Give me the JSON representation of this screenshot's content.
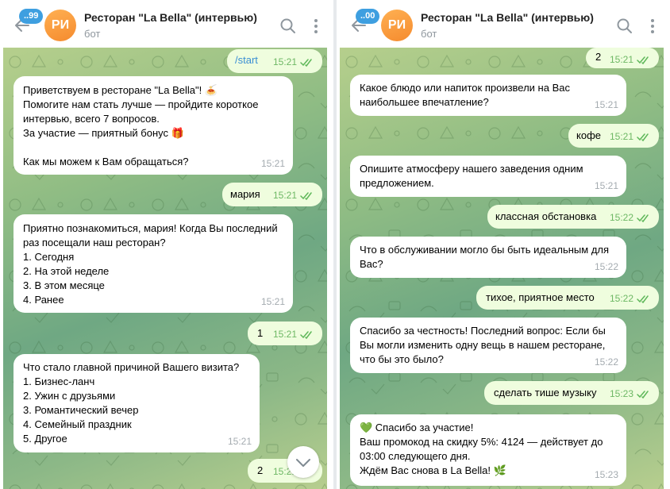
{
  "app": {
    "accent": "#3e9fe0",
    "incoming_bubble": "#ffffff",
    "outgoing_bubble": "#effdde"
  },
  "left": {
    "header": {
      "back_icon": "arrow-left-icon",
      "unread_badge": "..99",
      "avatar_initials": "РИ",
      "title": "Ресторан \"La Bella\" (интервью)",
      "subtitle": "бот",
      "search_icon": "search-icon",
      "more_icon": "more-vertical-icon"
    },
    "messages": [
      {
        "dir": "out",
        "text": "/start",
        "time": "15:21",
        "read": true
      },
      {
        "dir": "in",
        "text": "Приветствуем в ресторане \"La Bella\"! 🍝\nПомогите нам стать лучше — пройдите короткое интервью, всего 7 вопросов.\nЗа участие — приятный бонус 🎁\n\nКак мы можем к Вам обращаться?",
        "time": "15:21"
      },
      {
        "dir": "out",
        "text": "мария",
        "time": "15:21",
        "read": true
      },
      {
        "dir": "in",
        "text": "Приятно познакомиться, мария! Когда Вы последний раз посещали наш ресторан?\n1. Сегодня\n2. На этой неделе\n3. В этом месяце\n4. Ранее",
        "time": "15:21"
      },
      {
        "dir": "out",
        "text": "1",
        "time": "15:21",
        "read": true
      },
      {
        "dir": "in",
        "text": "Что стало главной причиной Вашего визита?\n1. Бизнес-ланч\n2. Ужин с друзьями\n3. Романтический вечер\n4. Семейный праздник\n5. Другое",
        "time": "15:21"
      },
      {
        "dir": "out",
        "text": "2",
        "time": "15:21",
        "read": true
      }
    ],
    "scroll_down_icon": "chevron-down-icon"
  },
  "right": {
    "header": {
      "back_icon": "arrow-left-icon",
      "unread_badge": "..00",
      "avatar_initials": "РИ",
      "title": "Ресторан \"La Bella\" (интервью)",
      "subtitle": "бот",
      "search_icon": "search-icon",
      "more_icon": "more-vertical-icon"
    },
    "messages": [
      {
        "dir": "out",
        "text": "2",
        "time": "15:21",
        "read": true
      },
      {
        "dir": "in",
        "text": "Какое блюдо или напиток произвели на Вас наибольшее впечатление?",
        "time": "15:21"
      },
      {
        "dir": "out",
        "text": "кофе",
        "time": "15:21",
        "read": true
      },
      {
        "dir": "in",
        "text": "Опишите атмосферу нашего заведения одним предложением.",
        "time": "15:21"
      },
      {
        "dir": "out",
        "text": "классная обстановка",
        "time": "15:22",
        "read": true
      },
      {
        "dir": "in",
        "text": "Что в обслуживании могло бы быть идеальным для Вас?",
        "time": "15:22"
      },
      {
        "dir": "out",
        "text": "тихое, приятное место",
        "time": "15:22",
        "read": true
      },
      {
        "dir": "in",
        "text": "Спасибо за честность! Последний вопрос: Если бы Вы могли изменить одну вещь в нашем ресторане, что бы это было?",
        "time": "15:22"
      },
      {
        "dir": "out",
        "text": "сделать тише музыку",
        "time": "15:23",
        "read": true
      },
      {
        "dir": "in",
        "text": "💚 Спасибо за участие!\nВаш промокод на скидку 5%: 4124 — действует до 03:00 следующего дня.\nЖдём Вас снова в La Bella! 🌿",
        "time": "15:23"
      }
    ]
  }
}
